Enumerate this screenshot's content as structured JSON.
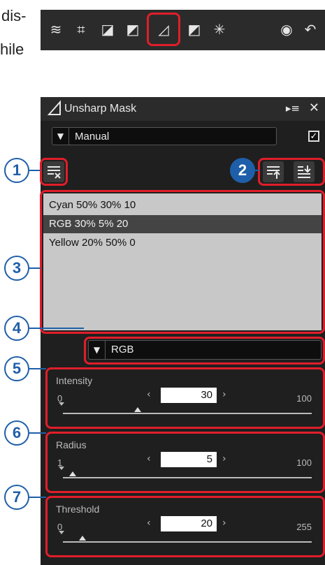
{
  "top_text": {
    "line1": "dis-",
    "line2": "hile"
  },
  "toolbar": {
    "icons": [
      "noise-reduction",
      "crop",
      "tone",
      "lch",
      "unsharp-mask",
      "color-booster",
      "retouch",
      "history",
      "undo"
    ]
  },
  "panel": {
    "title": "Unsharp Mask",
    "menu_glyph": "▸≡",
    "close_glyph": "✕",
    "mode_value": "Manual",
    "channel_value": "RGB",
    "presets": [
      "Cyan 50% 30% 10",
      "RGB 30% 5% 20",
      "Yellow 20% 50% 0"
    ],
    "selected_preset_index": 1
  },
  "params": {
    "intensity": {
      "label": "Intensity",
      "min": "0",
      "max": "100",
      "value": "30",
      "value_fraction": 0.3
    },
    "radius": {
      "label": "Radius",
      "min": "1",
      "max": "100",
      "value": "5",
      "value_fraction": 0.04
    },
    "threshold": {
      "label": "Threshold",
      "min": "0",
      "max": "255",
      "value": "20",
      "value_fraction": 0.08
    }
  },
  "callouts": [
    "1",
    "2",
    "3",
    "4",
    "5",
    "6",
    "7"
  ],
  "colors": {
    "callout": "#1f5fa9",
    "highlight": "#e01e2a"
  }
}
